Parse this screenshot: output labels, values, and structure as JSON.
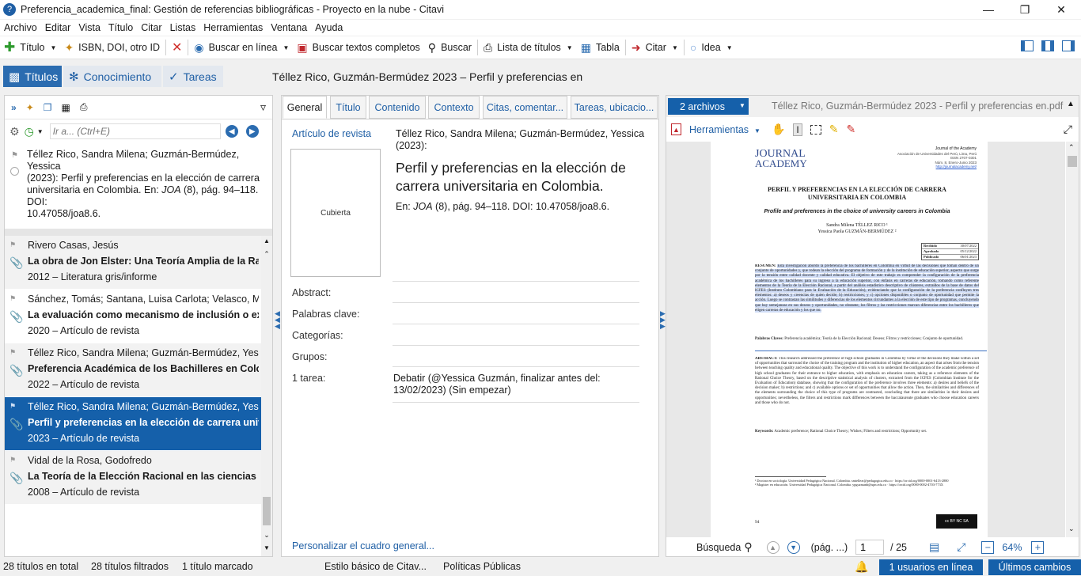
{
  "window": {
    "title": "Preferencia_academica_final: Gestión de referencias bibliográficas - Proyecto en la nube - Citavi"
  },
  "menu": [
    "Archivo",
    "Editar",
    "Vista",
    "Título",
    "Citar",
    "Listas",
    "Herramientas",
    "Ventana",
    "Ayuda"
  ],
  "toolbar": {
    "titulo": "Título",
    "isbn": "ISBN, DOI, otro ID",
    "buscar_online": "Buscar en línea",
    "buscar_textos": "Buscar textos completos",
    "buscar": "Buscar",
    "lista": "Lista de títulos",
    "tabla": "Tabla",
    "citar": "Citar",
    "idea": "Idea"
  },
  "nav": {
    "tabs": [
      "Títulos",
      "Conocimiento",
      "Tareas"
    ],
    "selected_title": "Téllez Rico, Guzmán-Bermúdez 2023 – Perfil y preferencias en"
  },
  "left": {
    "search_placeholder": "Ir a... (Ctrl+E)",
    "preview": [
      "Téllez Rico, Sandra Milena; Guzmán-Bermúdez, Yessica",
      "(2023): Perfil y preferencias en la elección de carrera",
      "universitaria en Colombia. En: ",
      "JOA",
      " (8), pág. 94–118. DOI:",
      "10.47058/joa8.6."
    ],
    "items": [
      {
        "authors": "Rivero Casas, Jesús",
        "title": "La obra de Jon Elster: Una Teoría Amplia de la Racion",
        "meta": "2012 – Literatura gris/informe"
      },
      {
        "authors": "Sánchez, Tomás; Santana, Luisa Carlota; Velasco, Mart",
        "title": "La evaluación como mecanismo de inclusión o exclus",
        "meta": "2020 – Artículo de revista"
      },
      {
        "authors": "Téllez Rico, Sandra Milena; Guzmán-Bermúdez, Yessic",
        "title": "Preferencia Académica de los Bachilleres en Colombi",
        "meta": "2022 – Artículo de revista"
      },
      {
        "authors": "Téllez Rico, Sandra Milena; Guzmán-Bermúdez, Yessic",
        "title": "Perfil y preferencias en la elección de carrera univer",
        "meta": "2023 – Artículo de revista"
      },
      {
        "authors": "Vidal de la Rosa, Godofredo",
        "title": "La Teoría de la Elección Racional en las ciencias social",
        "meta": "2008 – Artículo de revista"
      }
    ]
  },
  "mid": {
    "tabs": [
      "General",
      "Título",
      "Contenido",
      "Contexto",
      "Citas, comentar...",
      "Tareas, ubicacio..."
    ],
    "type": "Artículo de revista",
    "cover": "Cubierta",
    "authors": "Téllez Rico, Sandra Milena; Guzmán-Bermúdez, Yessica",
    "year": "(2023):",
    "title": "Perfil y preferencias en la elección de carrera universitaria en Colombia.",
    "source_pre": "En: ",
    "source_journal": "JOA",
    "source_post": " (8), pág. 94–118. DOI: 10.47058/joa8.6.",
    "labels": {
      "abstract": "Abstract:",
      "keywords": "Palabras clave:",
      "categories": "Categorías:",
      "groups": "Grupos:",
      "task": "1 tarea:"
    },
    "task": "Debatir (@Yessica Guzmán, finalizar antes del: 13/02/2023) (Sin empezar)",
    "customize": "Personalizar el cuadro general..."
  },
  "right": {
    "files": "2 archivos",
    "file_name": "Téllez Rico, Guzmán-Bermúdez 2023 - Perfil y preferencias en.pdf",
    "tools": "Herramientas",
    "search": "Búsqueda",
    "page_prefix": "(pág. ...)",
    "page": "1",
    "total": "/ 25",
    "zoom": "64%"
  },
  "pdf": {
    "logo1": "JOURNAL",
    "logo2": "ACADEMY",
    "hdr": [
      "Journal of the Academy",
      "Asociación de Universidades del Perú, Lima, Perú",
      "ISSN 2707-0301",
      "Núm. 8, Enero-Junio 2023",
      "http://journalacademy.net/"
    ],
    "title": "PERFIL Y PREFERENCIAS EN LA ELECCIÓN DE CARRERA UNIVERSITARIA EN COLOMBIA",
    "subtitle": "Profile and preferences in the choice of university careers in Colombia",
    "author1": "Sandra Milena TÉLLEZ RICO ¹",
    "author2": "Yessica Paola GUZMÁN-BERMÚDEZ ²",
    "dates": [
      [
        "Recibido",
        "30/07/2022"
      ],
      [
        "Aprobado",
        "05/12/2022"
      ],
      [
        "Publicado",
        "06/01/2023"
      ]
    ],
    "resumen_h": "RESUMEN:",
    "resumen": "Esta investigación abordó la preferencia de los bachilleres en Colombia en virtud de las decisiones que toman dentro de un conjunto de oportunidades y, que rodean la elección del programa de formación y de la institución de educación superior, aspecto que surge por la tensión entre calidad docente y calidad educativa. El objetivo de este trabajo es comprender la configuración de la preferencia académica de los bachilleres para su ingreso a la educación superior, con énfasis en carreras de educación, tomando como referente elementos de la Teoría de la Elección Racional, a partir del análisis estadístico descriptivo de clústeres, extraídos de la base de datos del ICFES (Instituto Colombiano para la Evaluación de la Educación), evidenciando que la configuración de la preferencia confluyen tres elementos: a) deseos y creencias de quien decide; b) restricciones; y c) opciones disponibles o conjunto de oportunidad que permite la acción. Luego se contrastan las similitudes y diferencias de los elementos circundantes a la elección de este tipo de programas, concluyendo que hay semejanzas en sus deseos y oportunidades, no obstante, los filtros y las restricciones marcan diferencias entre los bachilleres que eligen carreras de educación y los que no.",
    "palabras_h": "Palabras Claves:",
    "palabras": "Preferencia académica; Teoría de la Elección Racional; Deseos; Filtros y restricciones; Conjunto de oportunidad.",
    "abstract_h": "ABSTRACT:",
    "abstract": "This research addressed the preference of high school graduates in Colombia by virtue of the decisions they make within a set of opportunities that surround the choice of the training program and the institution of higher education, an aspect that arises from the tension between teaching quality and educational quality. The objective of this work is to understand the configuration of the academic preference of high school graduates for their entrance to higher education, with emphasis on education careers, taking as a reference elements of the Rational Choice Theory, based on the descriptive statistical analysis of clusters, extracted from the ICFES (Colombian Institute for the Evaluation of Education) database, showing that the configuration of the preference involves three elements: a) desires and beliefs of the decision maker; b) restrictions; and c) available options or set of opportunities that allow the action. Then, the similarities and differences of the elements surrounding the choice of this type of programs are contrasted, concluding that there are similarities in their desires and opportunities; nevertheless, the filters and restrictions mark differences between the baccalaureate graduates who choose education careers and those who do not.",
    "keywords_h": "Keywords:",
    "keywords": "Academic preference; Rational Choice Theory; Wishes; Filters and restrictions; Opportunity set.",
    "fn1": "¹ Doctora en sociología. Universidad Pedagógica Nacional. Colombia. smtellezr@pedagogica.edu.co · https://orcid.org/0000-0001-6413-2880",
    "fn2": "² Magíster en educación. Universidad Pedagógica Nacional. Colombia. ypguzmanb@upn.edu.co · https://orcid.org/0000-0002-4703-773X",
    "page": "94",
    "cc": "cc BY NC SA"
  },
  "status": {
    "total": "28 títulos en total",
    "filtered": "28 títulos filtrados",
    "marked": "1 título marcado",
    "style": "Estilo básico de Citav...",
    "policies": "Políticas Públicas",
    "users": "1 usuarios en línea",
    "changes": "Últimos cambios"
  },
  "colors": {
    "accent": "#1f5fa5",
    "selected_row": "#1560aa",
    "ribbon": "#2b6cb0"
  }
}
